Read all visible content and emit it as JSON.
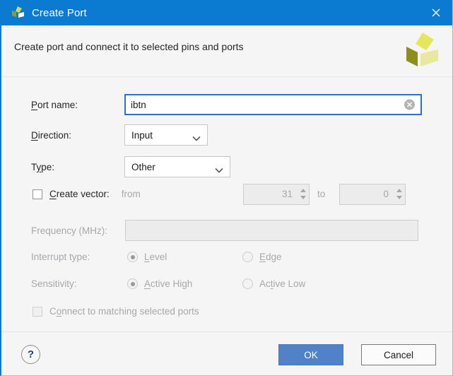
{
  "window": {
    "title": "Create Port",
    "logo_icon": "vivado-pinwheel-icon",
    "close_icon": "close-icon",
    "titlebar_color": "#0b7ad1"
  },
  "header": {
    "description": "Create port and connect it to selected pins and ports",
    "logo_icon": "vivado-pinwheel-icon"
  },
  "form": {
    "port_name": {
      "label_pre": "P",
      "label_post": "ort name:",
      "value": "ibtn",
      "placeholder": "",
      "clear_icon": "clear-circle-icon"
    },
    "direction": {
      "label_pre": "D",
      "label_post": "irection:",
      "value": "Input",
      "arrow_icon": "chevron-down-icon"
    },
    "type": {
      "label_pre_a": "T",
      "label_mn": "y",
      "label_post": "pe:",
      "value": "Other",
      "arrow_icon": "chevron-down-icon"
    },
    "create_vector": {
      "label_pre": "C",
      "label_post": "reate vector:",
      "checked": false,
      "from_label": "from",
      "from_value": "31",
      "to_label": "to",
      "to_value": "0"
    },
    "frequency": {
      "label": "Frequency (MHz):",
      "value": ""
    },
    "interrupt_type": {
      "label": "Interrupt type:",
      "options": [
        {
          "pre": "L",
          "post": "evel",
          "selected": true
        },
        {
          "pre": "E",
          "post": "dge",
          "selected": false
        }
      ]
    },
    "sensitivity": {
      "label": "Sensitivity:",
      "options": [
        {
          "pre": "A",
          "post": "ctive High",
          "selected": true
        },
        {
          "pre": "Ac",
          "mn": "t",
          "post": "ive Low",
          "selected": false
        }
      ]
    },
    "connect_ports": {
      "label_pre": "C",
      "label_mn": "o",
      "label_post": "nnect to matching selected ports",
      "checked": false
    }
  },
  "footer": {
    "help_label": "?",
    "ok_label": "OK",
    "cancel_label": "Cancel",
    "ok_color": "#5182c8"
  }
}
